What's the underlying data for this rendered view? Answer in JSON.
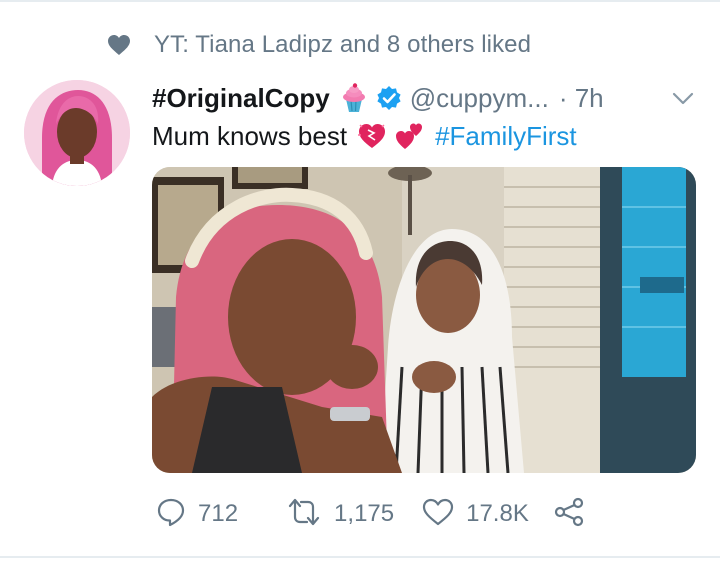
{
  "social_context": {
    "text": "YT: Tiana Ladipz and 8 others liked",
    "icon": "heart-filled-icon"
  },
  "tweet": {
    "display_name": "#OriginalCopy",
    "handle": "@cuppym...",
    "timestamp": "· 7h",
    "text": "Mum knows best",
    "hashtag": "#FamilyFirst",
    "emojis": [
      "cupcake-emoji",
      "verified-badge",
      "heart-exclamation-emoji",
      "two-hearts-emoji"
    ]
  },
  "actions": {
    "reply_count": "712",
    "retweet_count": "1,175",
    "like_count": "17.8K"
  },
  "colors": {
    "link": "#1b95e0",
    "secondary_text": "#657786",
    "verified": "#1da1f2",
    "divider": "#e6ecf0"
  }
}
